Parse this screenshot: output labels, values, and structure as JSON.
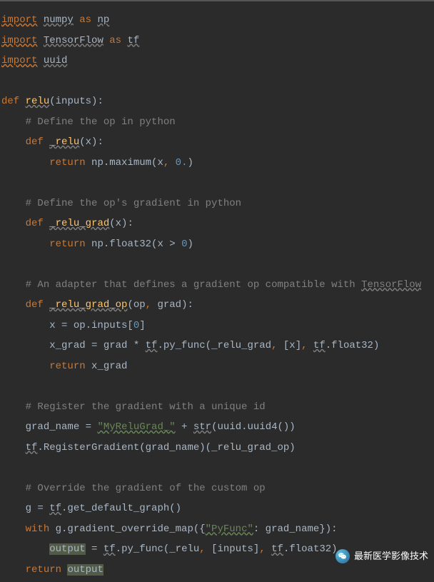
{
  "lines": {
    "l1_import": "import",
    "l1_numpy": "numpy",
    "l1_as": "as",
    "l1_np": "np",
    "l2_import": "import",
    "l2_tensorflow": "TensorFlow",
    "l2_as": "as",
    "l2_tf": "tf",
    "l3_import": "import",
    "l3_uuid": "uuid",
    "l5_def": "def",
    "l5_relu": "relu",
    "l5_params": "(inputs):",
    "l6_cmt": "# Define the op in python",
    "l7_def": "def",
    "l7_relu": "_relu",
    "l7_params": "(x):",
    "l8_return": "return",
    "l8_np": " np.maximum(x",
    "l8_comma": ",",
    "l8_zero": " 0.",
    "l8_paren": ")",
    "l10_cmt": "# Define the op's gradient in python",
    "l11_def": "def",
    "l11_relu_grad": "_relu_grad",
    "l11_params": "(x):",
    "l12_return": "return",
    "l12_np": " np.float32(x > ",
    "l12_zero": "0",
    "l12_paren": ")",
    "l14_cmt": "# An adapter that defines a gradient op compatible with ",
    "l14_tf": "TensorFlow",
    "l15_def": "def",
    "l15_relu_grad_op": "_relu_grad_op",
    "l15_params": "(op",
    "l15_comma": ",",
    "l15_params2": " grad):",
    "l16_code": "x = op.inputs[",
    "l16_zero": "0",
    "l16_bracket": "]",
    "l17_a": "x_grad = grad * ",
    "l17_tf": "tf",
    "l17_b": ".py_func(_relu_grad",
    "l17_c": ",",
    "l17_d": " [x]",
    "l17_e": ",",
    "l17_f": " ",
    "l17_tf2": "tf",
    "l17_g": ".float32)",
    "l18_return": "return",
    "l18_xgrad": " x_grad",
    "l20_cmt": "# Register the gradient with a unique id",
    "l21_a": "grad_name = ",
    "l21_str": "\"MyReluGrad_\"",
    "l21_b": " + ",
    "l21_str2": "str",
    "l21_c": "(uuid.uuid4())",
    "l22_tf": "tf",
    "l22_a": ".RegisterGradient(grad_name)(_relu_grad_op)",
    "l24_cmt": "# Override the gradient of the custom op",
    "l25_a": "g = ",
    "l25_tf": "tf",
    "l25_b": ".get_default_graph()",
    "l26_with": "with",
    "l26_a": " g.gradient_override_map({",
    "l26_str": "\"PyFunc\"",
    "l26_b": ": grad_name}):",
    "l27_out": "output",
    "l27_a": " = ",
    "l27_tf": "tf",
    "l27_b": ".py_func(_relu",
    "l27_c": ",",
    "l27_d": " [inputs]",
    "l27_e": ",",
    "l27_f": " ",
    "l27_tf2": "tf",
    "l27_g": ".float32)",
    "l28_return": "return",
    "l28_out": "output"
  },
  "watermark": "最新医学影像技术"
}
